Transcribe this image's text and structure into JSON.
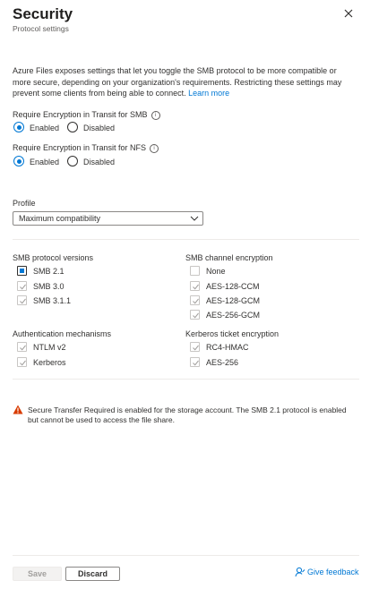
{
  "header": {
    "title": "Security",
    "subtitle": "Protocol settings"
  },
  "description": {
    "text": "Azure Files exposes settings that let you toggle the SMB protocol to be more compatible or more secure, depending on your organization's requirements. Restricting these settings may prevent some clients from being able to connect.",
    "link": "Learn more"
  },
  "smb_encryption": {
    "label": "Require Encryption in Transit for SMB",
    "options": [
      {
        "label": "Enabled",
        "selected": true
      },
      {
        "label": "Disabled",
        "selected": false
      }
    ]
  },
  "nfs_encryption": {
    "label": "Require Encryption in Transit for NFS",
    "options": [
      {
        "label": "Enabled",
        "selected": true
      },
      {
        "label": "Disabled",
        "selected": false
      }
    ]
  },
  "profile": {
    "label": "Profile",
    "value": "Maximum compatibility"
  },
  "smb_protocol_versions": {
    "label": "SMB protocol versions",
    "items": [
      {
        "label": "SMB 2.1",
        "state": "partial"
      },
      {
        "label": "SMB 3.0",
        "state": "checked-disabled"
      },
      {
        "label": "SMB 3.1.1",
        "state": "checked-disabled"
      }
    ]
  },
  "smb_channel_encryption": {
    "label": "SMB channel encryption",
    "items": [
      {
        "label": "None",
        "state": "unchecked-disabled"
      },
      {
        "label": "AES-128-CCM",
        "state": "checked-disabled"
      },
      {
        "label": "AES-128-GCM",
        "state": "checked-disabled"
      },
      {
        "label": "AES-256-GCM",
        "state": "checked-disabled"
      }
    ]
  },
  "authentication_mechanisms": {
    "label": "Authentication mechanisms",
    "items": [
      {
        "label": "NTLM v2",
        "state": "checked-disabled"
      },
      {
        "label": "Kerberos",
        "state": "checked-disabled"
      }
    ]
  },
  "kerberos_ticket_encryption": {
    "label": "Kerberos ticket encryption",
    "items": [
      {
        "label": "RC4-HMAC",
        "state": "checked-disabled"
      },
      {
        "label": "AES-256",
        "state": "checked-disabled"
      }
    ]
  },
  "warning": {
    "icon": "warning-icon",
    "text": "Secure Transfer Required is enabled for the storage account. The SMB 2.1 protocol is enabled but cannot be used to access the file share."
  },
  "footer": {
    "save_label": "Save",
    "discard_label": "Discard",
    "feedback_label": "Give feedback"
  },
  "colors": {
    "accent": "#0078d4",
    "warning": "#d83b01",
    "text": "#323130"
  }
}
